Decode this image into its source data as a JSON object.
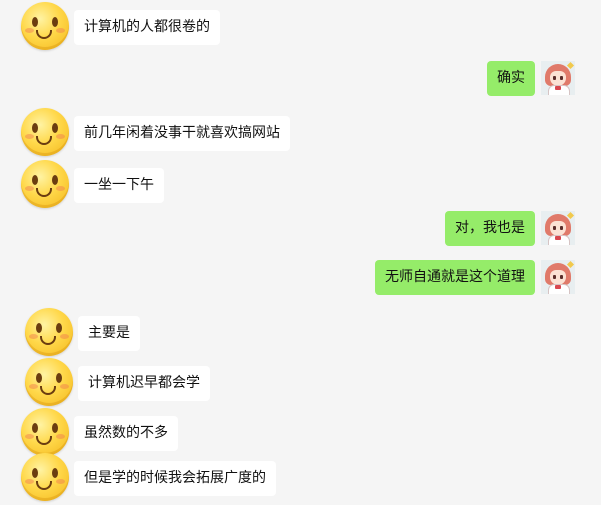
{
  "messages": [
    {
      "side": "left",
      "avatar": "smile-emoji",
      "text": "计算机的人都很卷的"
    },
    {
      "side": "right",
      "avatar": "anime-girl",
      "text": "确实"
    },
    {
      "side": "left",
      "avatar": "smile-emoji",
      "text": "前几年闲着没事干就喜欢搞网站"
    },
    {
      "side": "left",
      "avatar": "smile-emoji",
      "text": "一坐一下午"
    },
    {
      "side": "right",
      "avatar": "anime-girl",
      "text": "对，我也是"
    },
    {
      "side": "right",
      "avatar": "anime-girl",
      "text": "无师自通就是这个道理"
    },
    {
      "side": "left",
      "avatar": "smile-emoji",
      "text": "主要是"
    },
    {
      "side": "left",
      "avatar": "smile-emoji",
      "text": "计算机迟早都会学"
    },
    {
      "side": "left",
      "avatar": "smile-emoji",
      "text": "虽然数的不多"
    },
    {
      "side": "left",
      "avatar": "smile-emoji",
      "text": "但是学的时候我会拓展广度的"
    }
  ],
  "colors": {
    "background": "#f5f5f5",
    "incoming_bubble": "#ffffff",
    "outgoing_bubble": "#95ec69"
  }
}
